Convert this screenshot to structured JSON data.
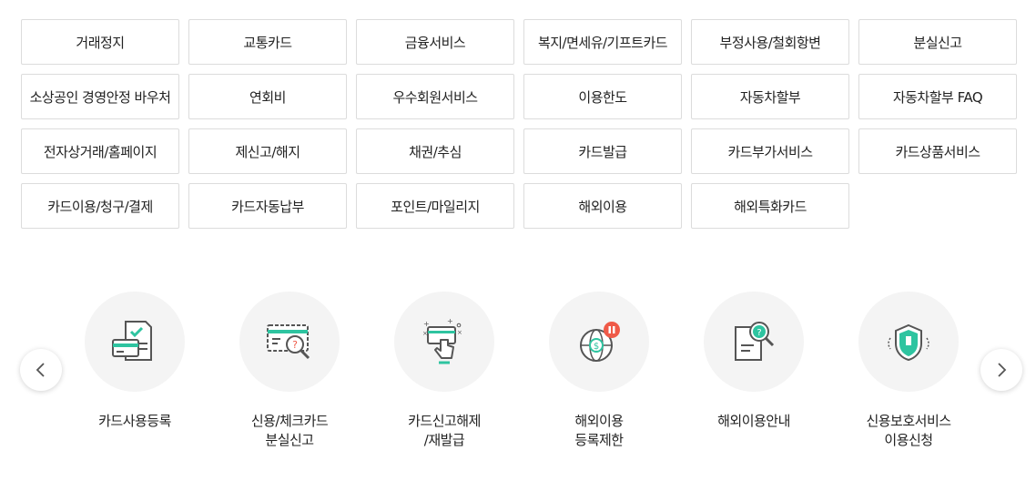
{
  "categories": [
    "거래정지",
    "교통카드",
    "금융서비스",
    "복지/면세유/기프트카드",
    "부정사용/철회항변",
    "분실신고",
    "소상공인 경영안정 바우처",
    "연회비",
    "우수회원서비스",
    "이용한도",
    "자동차할부",
    "자동차할부 FAQ",
    "전자상거래/홈페이지",
    "제신고/해지",
    "채권/추심",
    "카드발급",
    "카드부가서비스",
    "카드상품서비스",
    "카드이용/청구/결제",
    "카드자동납부",
    "포인트/마일리지",
    "해외이용",
    "해외특화카드"
  ],
  "services": [
    {
      "label": "카드사용등록",
      "icon": "card-register-icon"
    },
    {
      "label": "신용/체크카드\n분실신고",
      "icon": "lost-card-icon"
    },
    {
      "label": "카드신고해제\n/재발급",
      "icon": "card-release-icon"
    },
    {
      "label": "해외이용\n등록제한",
      "icon": "overseas-restrict-icon"
    },
    {
      "label": "해외이용안내",
      "icon": "overseas-guide-icon"
    },
    {
      "label": "신용보호서비스\n이용신청",
      "icon": "credit-protect-icon"
    }
  ],
  "nav": {
    "prev": "prev-arrow-icon",
    "next": "next-arrow-icon"
  },
  "colors": {
    "accent": "#2ec4a0",
    "alert": "#ef5a48",
    "icon_stroke": "#555555"
  }
}
